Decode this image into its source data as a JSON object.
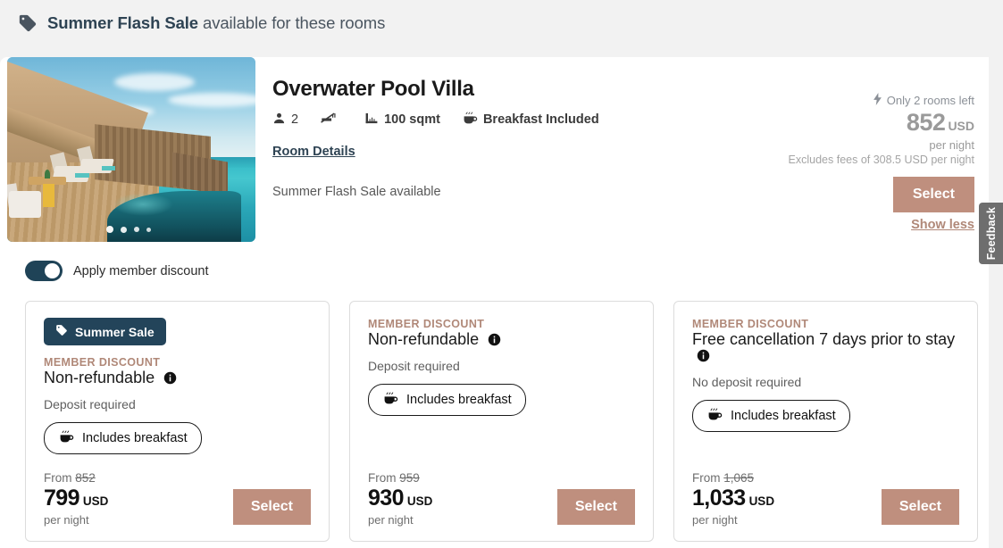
{
  "header": {
    "icon": "price-tag-icon",
    "promo_strong": "Summer Flash Sale",
    "promo_rest": " available for these rooms"
  },
  "room": {
    "title": "Overwater Pool Villa",
    "specs": [
      {
        "icon": "person-icon",
        "label": "2"
      },
      {
        "icon": "no-smoking-icon",
        "label": ""
      },
      {
        "icon": "ruler-icon",
        "label": "100 sqmt"
      },
      {
        "icon": "coffee-cup-icon",
        "label": "Breakfast Included"
      }
    ],
    "details_link": "Room Details",
    "sale_note": "Summer Flash Sale available",
    "carousel_dots": 4,
    "carousel_active": 0
  },
  "price_block": {
    "rooms_left_icon": "lightning-bolt-icon",
    "rooms_left": "Only 2 rooms left",
    "amount": "852",
    "currency": "USD",
    "per_night": "per night",
    "fees": "Excludes fees of 308.5 USD per night",
    "select_label": "Select",
    "show_less_label": "Show less"
  },
  "member_toggle": {
    "label": "Apply member discount",
    "state": "on"
  },
  "rate_cards": [
    {
      "badge": "Summer Sale",
      "badge_icon": "price-tag-icon",
      "member_discount": "MEMBER DISCOUNT",
      "name": "Non-refundable",
      "info_icon": "info-icon",
      "deposit": "Deposit required",
      "breakfast": "Includes breakfast",
      "breakfast_icon": "coffee-cup-icon",
      "from_label": "From",
      "from_price": "852",
      "price": "799",
      "currency": "USD",
      "per_night": "per night",
      "select_label": "Select"
    },
    {
      "badge": null,
      "member_discount": "MEMBER DISCOUNT",
      "name": "Non-refundable",
      "info_icon": "info-icon",
      "deposit": "Deposit required",
      "breakfast": "Includes breakfast",
      "breakfast_icon": "coffee-cup-icon",
      "from_label": "From",
      "from_price": "959",
      "price": "930",
      "currency": "USD",
      "per_night": "per night",
      "select_label": "Select"
    },
    {
      "badge": null,
      "member_discount": "MEMBER DISCOUNT",
      "name": "Free cancellation 7 days prior to stay",
      "info_icon": "info-icon",
      "deposit": "No deposit required",
      "breakfast": "Includes breakfast",
      "breakfast_icon": "coffee-cup-icon",
      "from_label": "From",
      "from_price": "1,065",
      "price": "1,033",
      "currency": "USD",
      "per_night": "per night",
      "select_label": "Select"
    }
  ],
  "feedback": {
    "label": "Feedback"
  },
  "colors": {
    "page_bg": "#f2f2f2",
    "navy": "#23445a",
    "rose": "#bf8f7e",
    "member_rose": "#b08878",
    "muted": "#9a9a9a"
  }
}
